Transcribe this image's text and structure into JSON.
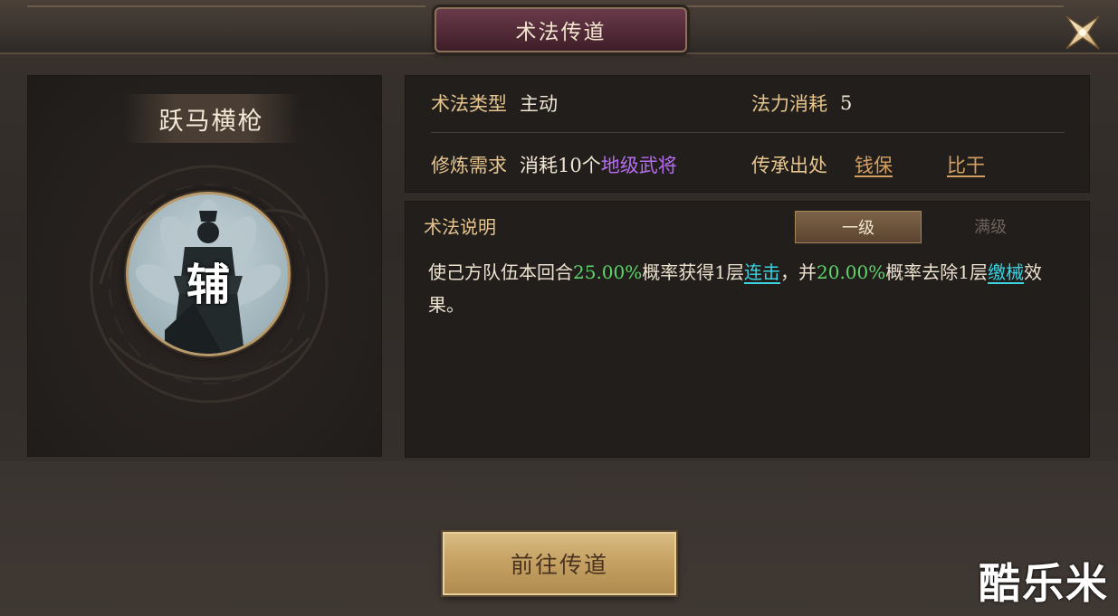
{
  "window": {
    "title": "术法传道"
  },
  "skill": {
    "name": "跃马横枪",
    "portrait_glyph": "辅"
  },
  "info": {
    "type_label": "术法类型",
    "type_value": "主动",
    "mana_label": "法力消耗",
    "mana_value": "5",
    "req_label": "修炼需求",
    "req_prefix": "消耗10个",
    "req_highlight": "地级武将",
    "source_label": "传承出处",
    "sources": [
      "钱保",
      "比干"
    ]
  },
  "description": {
    "title": "术法说明",
    "tabs": [
      "一级",
      "满级"
    ],
    "active_tab": 0,
    "parts": {
      "p1": "使己方队伍本回合",
      "v1": "25.00%",
      "p2": "概率获得1层",
      "k1": "连击",
      "p3": "，并",
      "v2": "20.00%",
      "p4": "概率去除1层",
      "k2": "缴械",
      "p5": "效果。"
    }
  },
  "actions": {
    "go_label": "前往传道"
  },
  "watermark": "酷乐米",
  "colors": {
    "gold_label": "#e6c58e",
    "purple": "#b56cf0",
    "green": "#5dd56a",
    "cyan": "#3bd3e0",
    "button_gold": "#c6a264"
  },
  "icons": {
    "close": "close-x-icon"
  }
}
